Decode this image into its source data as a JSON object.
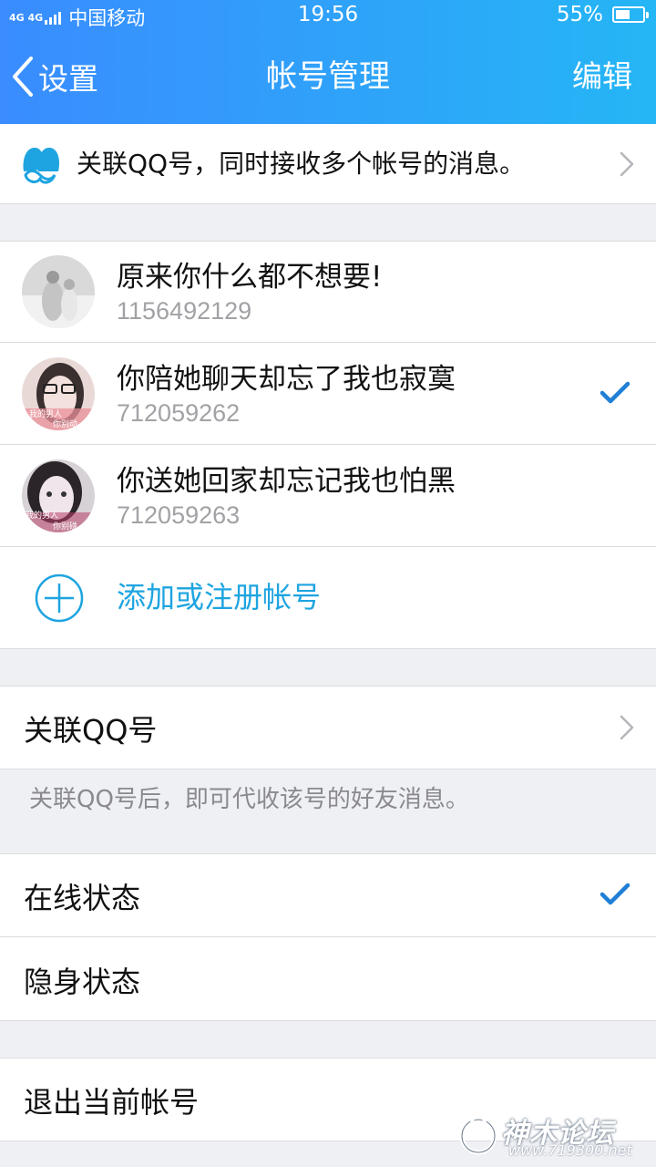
{
  "status_bar": {
    "network": "4G 4G",
    "carrier": "中国移动",
    "time": "19:56",
    "battery": "55%",
    "battery_level": 0.55
  },
  "nav": {
    "back_label": "设置",
    "title": "帐号管理",
    "edit_label": "编辑"
  },
  "banner": {
    "text": "关联QQ号，同时接收多个帐号的消息。"
  },
  "accounts": [
    {
      "name": "原来你什么都不想要!",
      "number": "1156492129",
      "selected": false
    },
    {
      "name": "你陪她聊天却忘了我也寂寞",
      "number": "712059262",
      "selected": true,
      "avatar_text": [
        "我的男人",
        "你别动"
      ]
    },
    {
      "name": "你送她回家却忘记我也怕黑",
      "number": "712059263",
      "selected": false,
      "avatar_text": [
        "我的男人",
        "你别碰"
      ]
    }
  ],
  "add_account": {
    "label": "添加或注册帐号"
  },
  "link_qq": {
    "label": "关联QQ号",
    "hint": "关联QQ号后，即可代收该号的好友消息。"
  },
  "status_options": [
    {
      "label": "在线状态",
      "selected": true
    },
    {
      "label": "隐身状态",
      "selected": false
    }
  ],
  "logout": {
    "label": "退出当前帐号"
  },
  "watermark": {
    "text": "神木论坛",
    "url": "www.719300.net"
  },
  "colors": {
    "header_start": "#3a8cff",
    "header_end": "#25b6f5",
    "accent": "#1ea4e0",
    "check": "#1f7fd6",
    "secondary_text": "#a2a2a6"
  }
}
